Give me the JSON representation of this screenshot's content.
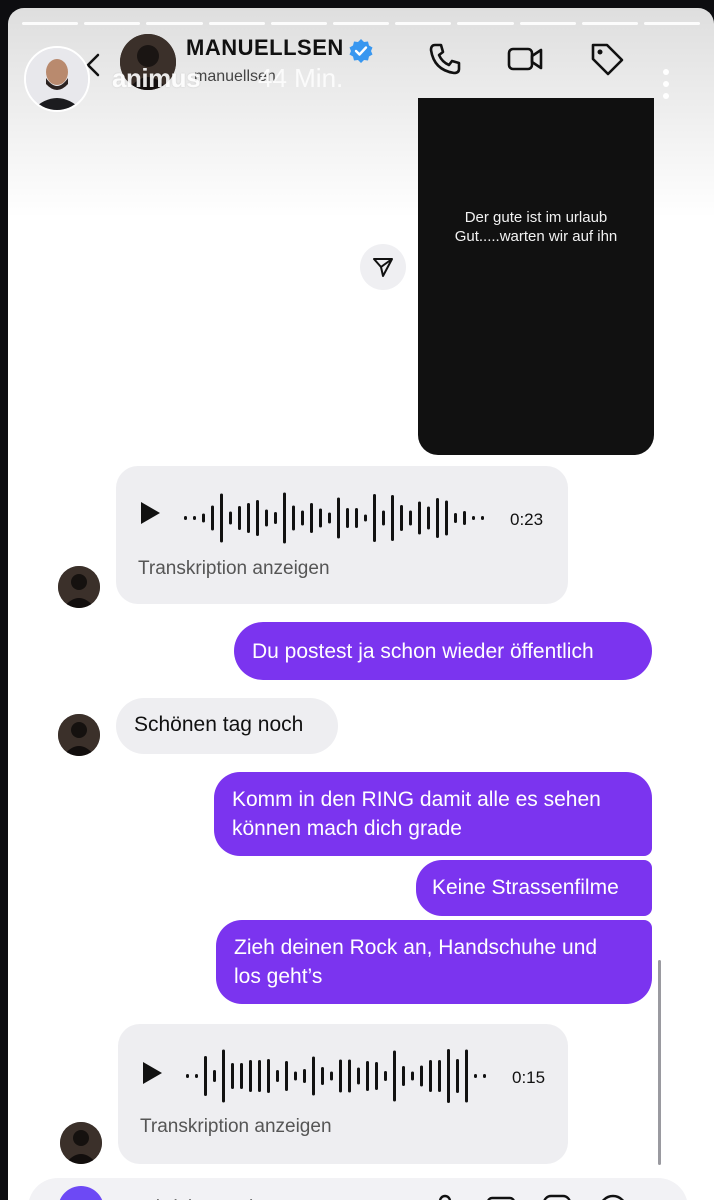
{
  "story": {
    "username": "animus",
    "time": "44 Min.",
    "progress_segments": 11
  },
  "dm_header": {
    "name": "MANUELLSEN",
    "username": "manuellsen",
    "verified": true
  },
  "shared_story": {
    "line1": "Der gute ist im urlaub",
    "line2": "Gut.....warten wir auf ihn"
  },
  "messages": [
    {
      "type": "voice",
      "sender": "them",
      "duration": "0:23",
      "transcript_label": "Transkription anzeigen"
    },
    {
      "type": "text",
      "sender": "me",
      "text": "Du postest ja schon wieder öffentlich"
    },
    {
      "type": "text",
      "sender": "them",
      "text": "Schönen tag noch"
    },
    {
      "type": "text",
      "sender": "me",
      "line1": "Komm in den RING damit alle es sehen",
      "line2": "können mach dich grade"
    },
    {
      "type": "text",
      "sender": "me",
      "text": "Keine Strassenfilme"
    },
    {
      "type": "text",
      "sender": "me",
      "line1": "Zieh deinen Rock an, Handschuhe und",
      "line2": "los geht’s"
    },
    {
      "type": "voice",
      "sender": "them",
      "duration": "0:15",
      "transcript_label": "Transkription anzeigen"
    }
  ],
  "composer": {
    "placeholder": "Nachricht senden..."
  },
  "colors": {
    "outgoing_bubble": "#7b34ef",
    "incoming_bubble": "#eeeef1",
    "camera_button": "#6d49f5",
    "verified_badge": "#3897f0"
  }
}
